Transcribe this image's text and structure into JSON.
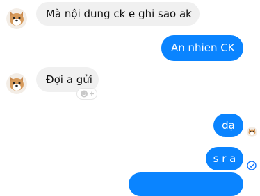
{
  "conversation": {
    "messages": [
      {
        "sender": "other",
        "text": "Mà nội dung ck e ghi sao ak"
      },
      {
        "sender": "me",
        "text": "An nhien CK"
      },
      {
        "sender": "other",
        "text": "Đợi a gửi"
      },
      {
        "sender": "me",
        "text": "dạ",
        "status": "seen"
      },
      {
        "sender": "me",
        "text": "s r a",
        "status": "delivered"
      },
      {
        "sender": "me",
        "text": "",
        "partial": true
      }
    ]
  },
  "icons": {
    "avatar": "shiba-avatar",
    "reaction_add": "add-reaction-icon",
    "delivered": "check-circle-icon"
  },
  "colors": {
    "outgoing_bubble": "#0a84ff",
    "incoming_bubble": "#f0f0f0",
    "status_blue": "#1677ff"
  }
}
